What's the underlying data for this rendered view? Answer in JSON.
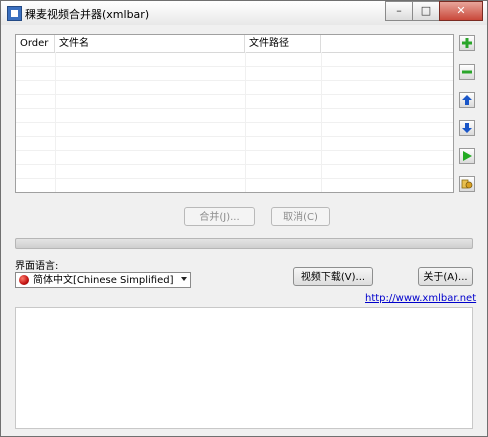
{
  "window": {
    "title": "稞麦视频合并器(xmlbar)"
  },
  "caption": {
    "minimize": "–",
    "maximize": "□",
    "close": "✕"
  },
  "list": {
    "columns": [
      "Order",
      "文件名",
      "文件路径"
    ],
    "rows": []
  },
  "side_icons": [
    "add-icon",
    "remove-icon",
    "move-up-icon",
    "move-down-icon",
    "play-icon",
    "settings-icon"
  ],
  "actions": {
    "merge_label": "合并(J)...",
    "cancel_label": "取消(C)"
  },
  "progress": {
    "value": 0
  },
  "language": {
    "label": "界面语言:",
    "selected": "简体中文[Chinese Simplified]"
  },
  "buttons": {
    "download_label": "视频下载(V)...",
    "about_label": "关于(A)..."
  },
  "link": {
    "url_text": "http://www.xmlbar.net"
  },
  "colors": {
    "add": "#2aa52a",
    "remove": "#2aa52a",
    "arrows": "#1a56c8",
    "play": "#22aa22",
    "link": "#0000cc"
  }
}
